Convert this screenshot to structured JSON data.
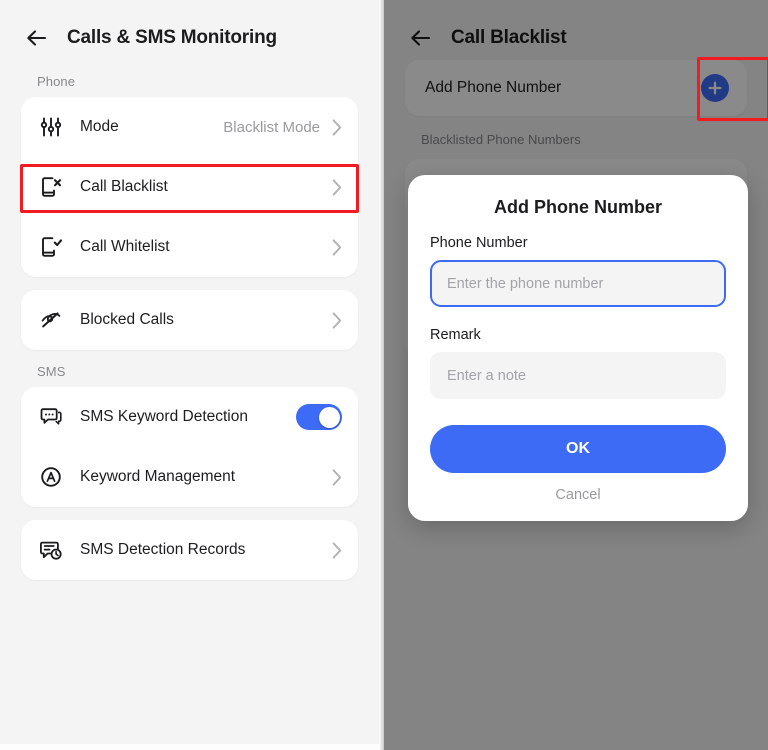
{
  "left_panel": {
    "header": {
      "back_icon": "back-arrow-icon",
      "title": "Calls & SMS Monitoring"
    },
    "sections": [
      {
        "label": "Phone",
        "groups": [
          {
            "rows": [
              {
                "icon": "sliders-icon",
                "label": "Mode",
                "value": "Blacklist Mode",
                "accessory": "chevron-right-icon",
                "highlighted": false
              },
              {
                "icon": "phone-block-x-icon",
                "label": "Call Blacklist",
                "value": "",
                "accessory": "chevron-right-icon",
                "highlighted": true
              },
              {
                "icon": "phone-check-icon",
                "label": "Call Whitelist",
                "value": "",
                "accessory": "chevron-right-icon",
                "highlighted": false
              }
            ]
          },
          {
            "rows": [
              {
                "icon": "call-blocked-icon",
                "label": "Blocked Calls",
                "value": "",
                "accessory": "chevron-right-icon",
                "highlighted": false
              }
            ]
          }
        ]
      },
      {
        "label": "SMS",
        "groups": [
          {
            "rows": [
              {
                "icon": "sms-bubble-icon",
                "label": "SMS Keyword Detection",
                "value": "",
                "accessory": "toggle-on",
                "highlighted": false
              },
              {
                "icon": "letter-a-circle-icon",
                "label": "Keyword Management",
                "value": "",
                "accessory": "chevron-right-icon",
                "highlighted": false
              }
            ]
          },
          {
            "rows": [
              {
                "icon": "sms-records-clock-icon",
                "label": "SMS Detection Records",
                "value": "",
                "accessory": "chevron-right-icon",
                "highlighted": false
              }
            ]
          }
        ]
      }
    ]
  },
  "right_panel": {
    "header": {
      "back_icon": "back-arrow-icon",
      "title": "Call Blacklist"
    },
    "add_bar": {
      "label": "Add Phone Number",
      "button_icon": "plus-circle-icon"
    },
    "list_label": "Blacklisted Phone Numbers"
  },
  "modal": {
    "title": "Add Phone Number",
    "phone_label": "Phone Number",
    "phone_placeholder": "Enter the phone number",
    "phone_value": "",
    "remark_label": "Remark",
    "remark_placeholder": "Enter a note",
    "remark_value": "",
    "ok_label": "OK",
    "cancel_label": "Cancel"
  },
  "colors": {
    "accent": "#3d6bf5",
    "highlight": "#f31b22",
    "background": "#f4f4f4",
    "card": "#ffffff",
    "text_primary": "#1e1e20",
    "text_secondary": "#9a9aa0"
  }
}
